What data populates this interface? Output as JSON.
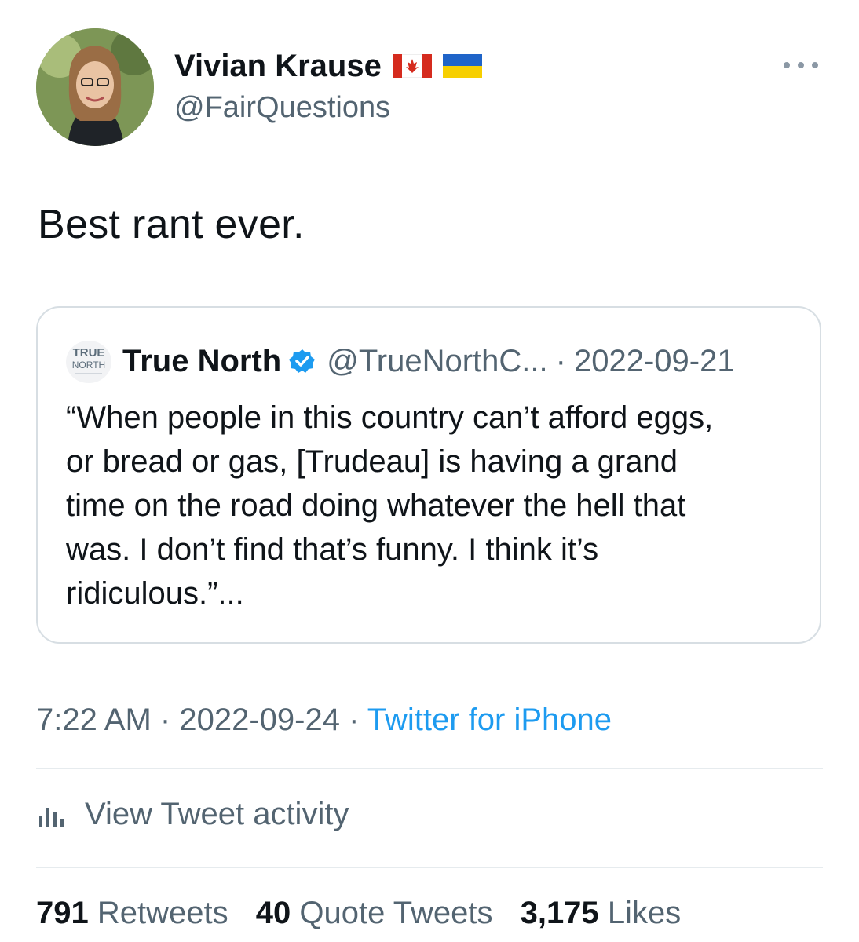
{
  "author": {
    "name": "Vivian Krause",
    "handle": "@FairQuestions",
    "flags": [
      "canada-flag-icon",
      "ukraine-flag-icon"
    ]
  },
  "tweet": {
    "text": "Best rant ever."
  },
  "quote": {
    "logo_text_top": "TRUE",
    "logo_text_bottom": "NORTH",
    "name": "True North",
    "handle": "@TrueNorthC...",
    "date": "2022-09-21",
    "text": "“When people in this country can’t afford eggs,\nor bread or gas, [Trudeau] is having a grand\ntime on the road doing whatever the hell that\nwas. I don’t find that’s funny. I think it’s\nridiculous.”..."
  },
  "meta": {
    "time": "7:22 AM",
    "date": "2022-09-24",
    "source": "Twitter for iPhone"
  },
  "activity": {
    "label": "View Tweet activity"
  },
  "stats": {
    "retweets_count": "791",
    "retweets_label": "Retweets",
    "quotes_count": "40",
    "quotes_label": "Quote Tweets",
    "likes_count": "3,175",
    "likes_label": "Likes"
  },
  "colors": {
    "text": "#0f1419",
    "secondary": "#536471",
    "link": "#1d9bf0",
    "border": "#d7dee3"
  }
}
